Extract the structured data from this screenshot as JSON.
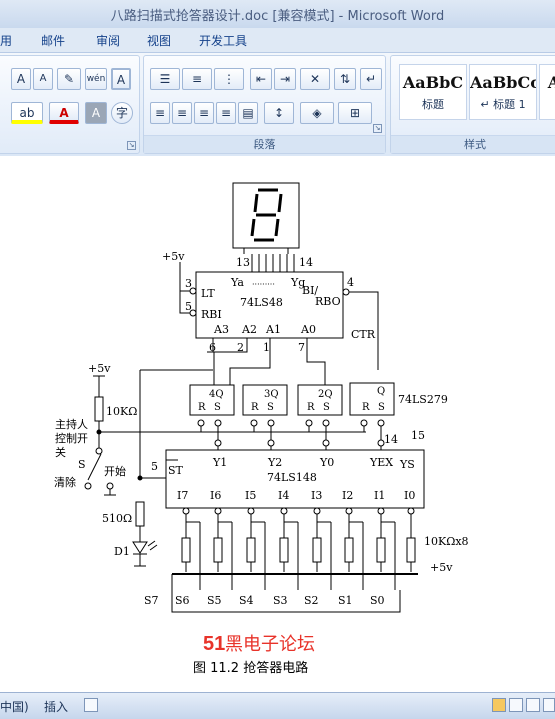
{
  "window": {
    "title": "八路扫描式抢答器设计.doc [兼容模式] - Microsoft Word"
  },
  "menu": [
    "用",
    "邮件",
    "审阅",
    "视图",
    "开发工具"
  ],
  "ribbon": {
    "font_group": {
      "grow": "A",
      "shrink": "A",
      "phonetic": "wén",
      "border_char": "A",
      "circle_char": "字",
      "font_color_label": "A",
      "highlight_label": "ab"
    },
    "paragraph_group": {
      "label": "段落"
    },
    "styles_group": {
      "label": "样式",
      "styles": [
        {
          "sample": "AaBbC",
          "name": "标题"
        },
        {
          "sample": "AaBbCc",
          "name": "↵ 标题 1"
        },
        {
          "sample": "A",
          "name": ""
        }
      ]
    }
  },
  "circuit": {
    "labels": {
      "seg_pins_left": "13",
      "seg_pins_right": "14",
      "vcc_top": "+5v",
      "pin3": "3",
      "pin5": "5",
      "pin4": "4",
      "ya": "Ya",
      "yg": "Yg",
      "dots": "·········",
      "lt": "LT",
      "bi": "BI/",
      "rbo": "RBO",
      "rbi": "RBI",
      "ic48": "74LS48",
      "a3": "A3",
      "a2": "A2",
      "a1": "A1",
      "a0": "A0",
      "ctr": "CTR",
      "p6": "6",
      "p2": "2",
      "p1": "1",
      "p7": "7",
      "vcc_left": "+5v",
      "r10k": "10KΩ",
      "host1": "主持人",
      "host2": "控制开",
      "host3": "关",
      "s_label": "S",
      "start": "开始",
      "clear": "清除",
      "q4": "4Q",
      "q3": "3Q",
      "q2": "2Q",
      "q": "Q",
      "ic279": "74LS279",
      "r": "R",
      "s": "S",
      "p14": "14",
      "p15": "15",
      "p5b": "5",
      "st": "ST",
      "y1": "Y1",
      "y2": "Y2",
      "y0": "Y0",
      "yex": "YEX",
      "ys": "YS",
      "ic148": "74LS148",
      "inputs": [
        "I7",
        "I6",
        "I5",
        "I4",
        "I3",
        "I2",
        "I1",
        "I0"
      ],
      "r510": "510Ω",
      "d1": "D1",
      "r10kx8": "10KΩx8",
      "vcc_bus": "+5v",
      "switches": [
        "S7",
        "S6",
        "S5",
        "S4",
        "S3",
        "S2",
        "S1",
        "S0"
      ]
    }
  },
  "watermark": {
    "num": "51",
    "text": "黑电子论坛",
    "color": "#e8332a"
  },
  "caption": "图 11.2 抢答器电路",
  "status": {
    "lang": "中国)",
    "mode": "插入"
  }
}
